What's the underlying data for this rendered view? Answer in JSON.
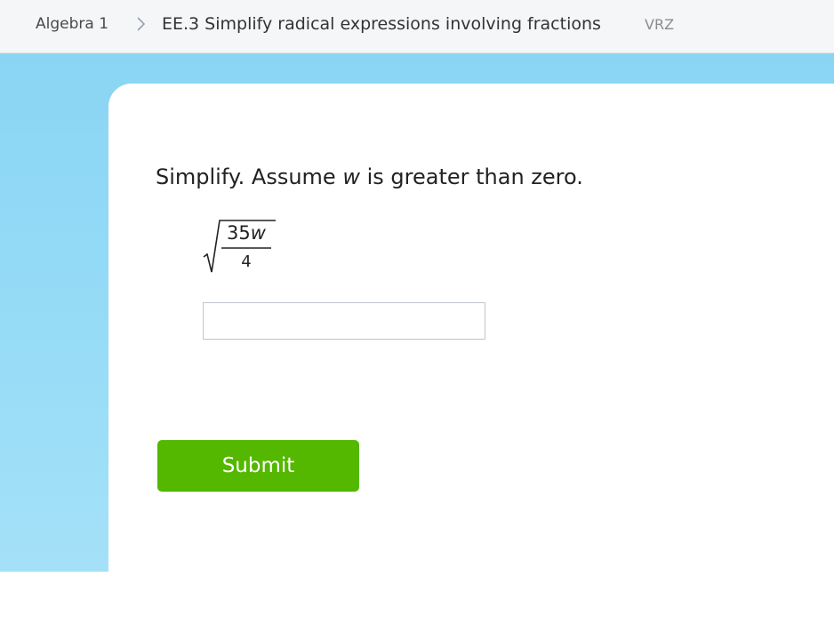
{
  "breadcrumb": {
    "root": "Algebra 1",
    "skill": "EE.3 Simplify radical expressions involving fractions",
    "code": "VRZ"
  },
  "question": {
    "prompt_before": "Simplify. Assume ",
    "prompt_var": "w",
    "prompt_after": " is greater than zero.",
    "numerator_number": "35",
    "numerator_var": "w",
    "denominator": "4"
  },
  "answer": {
    "value": "",
    "placeholder": ""
  },
  "submit": {
    "label": "Submit"
  },
  "colors": {
    "sky": "#8ad5f4",
    "submit": "#54b700",
    "card": "#ffffff",
    "topbar": "#f4f6f8"
  },
  "icons": {
    "breadcrumb_separator": "chevron-right-icon",
    "radical": "square-root-icon"
  }
}
